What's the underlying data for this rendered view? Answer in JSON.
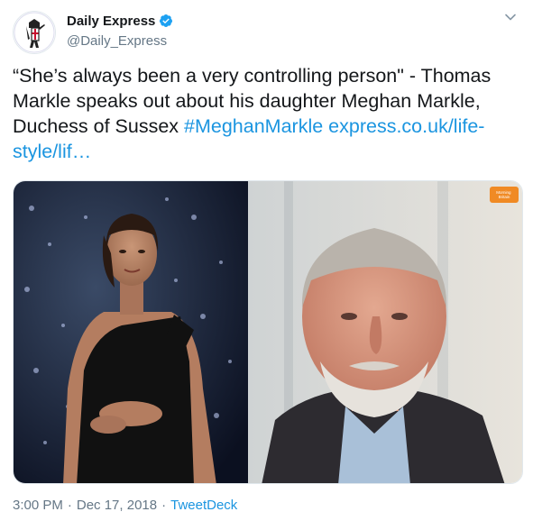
{
  "account": {
    "display_name": "Daily Express",
    "handle": "@Daily_Express",
    "avatar_icon": "crusader-knight-logo-icon",
    "verified_icon": "verified-badge-icon",
    "verified_color": "#1da1f2"
  },
  "tweet": {
    "text_plain": "“She’s always been a very controlling person\" - Thomas Markle speaks out about his daughter Meghan Markle, Duchess of Sussex",
    "hashtag": "#MeghanMarkle",
    "link": "express.co.uk/life-style/lif…",
    "link_color": "#1b95e0"
  },
  "media": {
    "left_image": "meghan-markle-photo",
    "right_image": "thomas-markle-tv-interview-photo",
    "badge_text": "Morning Britain"
  },
  "footer": {
    "time": "3:00 PM",
    "separator": "·",
    "date": "Dec 17, 2018",
    "source": "TweetDeck"
  },
  "menu_icon": "chevron-down-icon"
}
